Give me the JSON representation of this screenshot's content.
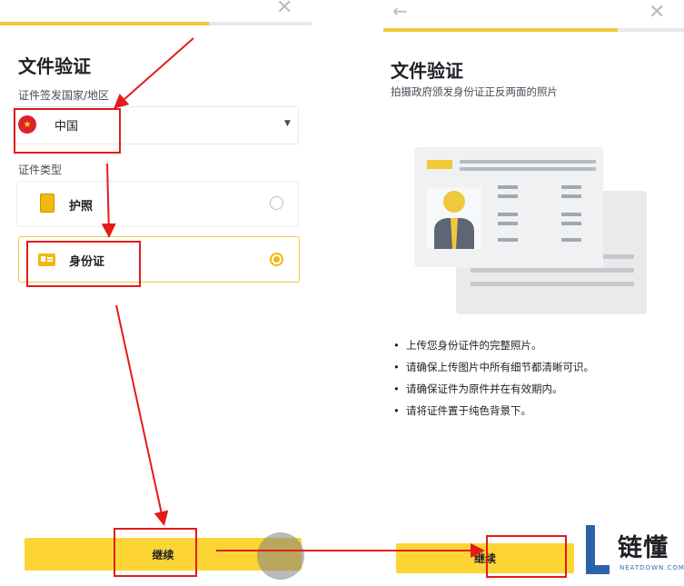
{
  "left_screen": {
    "progress": 0.67,
    "title": "文件验证",
    "country_label": "证件签发国家/地区",
    "country_value": "中国",
    "document_type_label": "证件类型",
    "options": [
      {
        "label": "护照",
        "selected": false,
        "icon": "passport-icon"
      },
      {
        "label": "身份证",
        "selected": true,
        "icon": "id-card-icon"
      }
    ],
    "continue_label": "继续"
  },
  "right_screen": {
    "progress": 0.78,
    "title": "文件验证",
    "subtitle": "拍摄政府颁发身份证正反两面的照片",
    "tips": [
      "上传您身份证件的完整照片。",
      "请确保上传图片中所有细节都清晰可识。",
      "请确保证件为原件并在有效期内。",
      "请将证件置于纯色背景下。"
    ],
    "continue_label": "继续"
  },
  "colors": {
    "accent": "#fcd535",
    "annotation": "#e31b1b",
    "text": "#1e2026",
    "muted": "#474d57"
  },
  "watermark": {
    "title": "链懂",
    "subtitle": "NEATDOWN.COM"
  }
}
